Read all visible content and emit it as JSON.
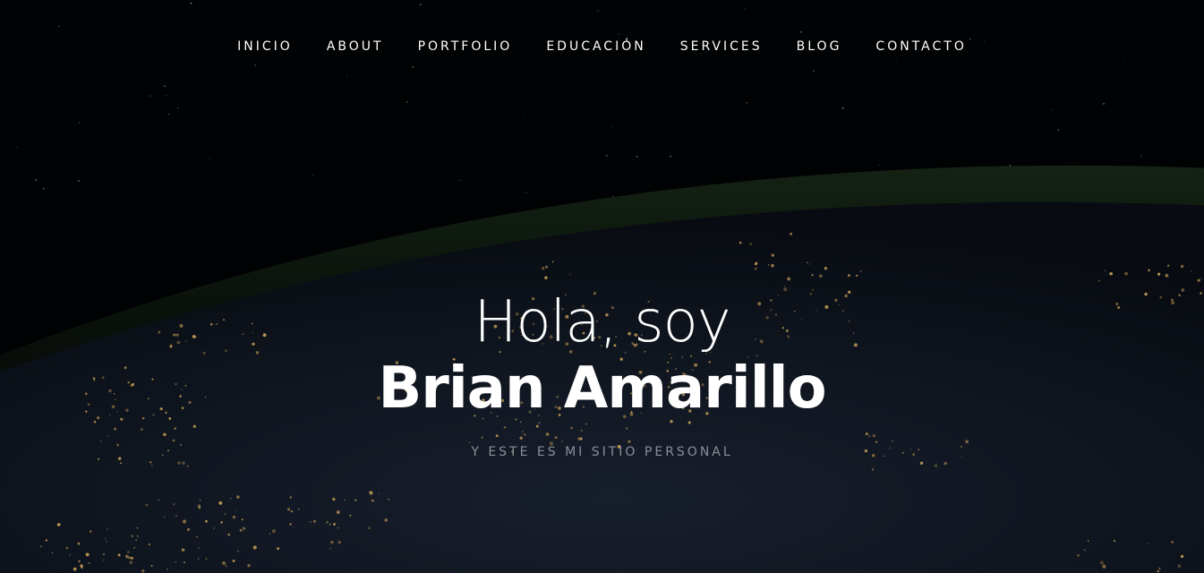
{
  "nav": {
    "items": [
      {
        "label": "INICIO"
      },
      {
        "label": "ABOUT"
      },
      {
        "label": "PORTFOLIO"
      },
      {
        "label": "EDUCACIÓN"
      },
      {
        "label": "SERVICES"
      },
      {
        "label": "BLOG"
      },
      {
        "label": "CONTACTO"
      }
    ]
  },
  "hero": {
    "greeting": "Hola, soy",
    "name": "Brian Amarillo",
    "tagline": "Y ESTE ES MI SITIO PERSONAL"
  },
  "colors": {
    "text": "#ffffff",
    "tagline": "#8a8f96",
    "background": "#020304",
    "city_lights": "#f5c36b"
  }
}
